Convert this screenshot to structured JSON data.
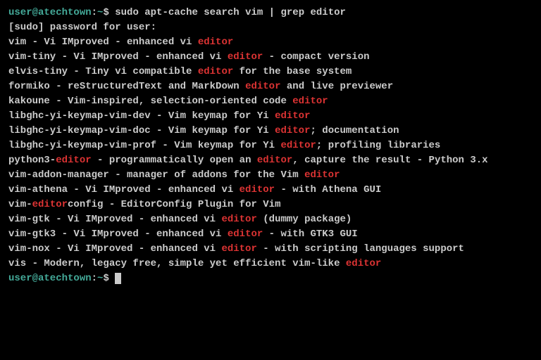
{
  "prompt": {
    "user": "user@atechtown",
    "sep1": ":",
    "path": "~",
    "sep2": "$ "
  },
  "command": "sudo apt-cache search vim | grep editor",
  "sudo_line": "[sudo] password for user:",
  "highlight": "editor",
  "results": [
    {
      "pre": "vim - Vi IMproved - enhanced vi ",
      "hl": "editor",
      "post": ""
    },
    {
      "pre": "vim-tiny - Vi IMproved - enhanced vi ",
      "hl": "editor",
      "post": " - compact version"
    },
    {
      "pre": "elvis-tiny - Tiny vi compatible ",
      "hl": "editor",
      "post": " for the base system"
    },
    {
      "pre": "formiko - reStructuredText and MarkDown ",
      "hl": "editor",
      "post": " and live previewer"
    },
    {
      "pre": "kakoune - Vim-inspired, selection-oriented code ",
      "hl": "editor",
      "post": ""
    },
    {
      "pre": "libghc-yi-keymap-vim-dev - Vim keymap for Yi ",
      "hl": "editor",
      "post": ""
    },
    {
      "pre": "libghc-yi-keymap-vim-doc - Vim keymap for Yi ",
      "hl": "editor",
      "post": "; documentation"
    },
    {
      "pre": "libghc-yi-keymap-vim-prof - Vim keymap for Yi ",
      "hl": "editor",
      "post": "; profiling libraries"
    },
    {
      "pre": "python3-",
      "hl": "editor",
      "mid": " - programmatically open an ",
      "hl2": "editor",
      "post": ", capture the result - Python 3.x"
    },
    {
      "pre": "vim-addon-manager - manager of addons for the Vim ",
      "hl": "editor",
      "post": ""
    },
    {
      "pre": "vim-athena - Vi IMproved - enhanced vi ",
      "hl": "editor",
      "post": " - with Athena GUI"
    },
    {
      "pre": "vim-",
      "hl": "editor",
      "post": "config - EditorConfig Plugin for Vim"
    },
    {
      "pre": "vim-gtk - Vi IMproved - enhanced vi ",
      "hl": "editor",
      "post": " (dummy package)"
    },
    {
      "pre": "vim-gtk3 - Vi IMproved - enhanced vi ",
      "hl": "editor",
      "post": " - with GTK3 GUI"
    },
    {
      "pre": "vim-nox - Vi IMproved - enhanced vi ",
      "hl": "editor",
      "post": " - with scripting languages support"
    },
    {
      "pre": "vis - Modern, legacy free, simple yet efficient vim-like ",
      "hl": "editor",
      "post": ""
    }
  ]
}
